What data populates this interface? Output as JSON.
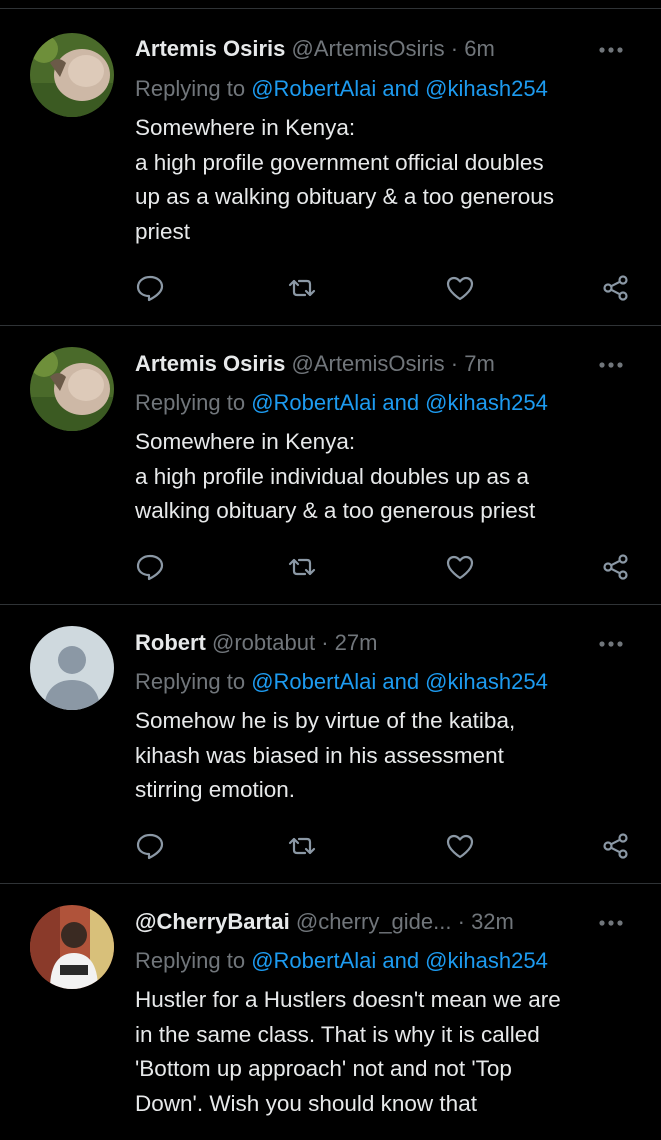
{
  "colors": {
    "background": "#000000",
    "divider": "#2f3336",
    "text_primary": "#e7e9ea",
    "text_secondary": "#71767b",
    "link": "#1d9bf0"
  },
  "tweets": [
    {
      "avatar_icon": "user-photo-avatar",
      "name": "Artemis Osiris",
      "handle": "@ArtemisOsiris",
      "separator": "·",
      "time": "6m",
      "replying_label": "Replying to",
      "replying_mentions": "@RobertAlai and @kihash254",
      "lines": [
        "Somewhere in Kenya:",
        "a high profile government official doubles",
        "up as a walking obituary & a too generous",
        "priest"
      ]
    },
    {
      "avatar_icon": "user-photo-avatar",
      "name": "Artemis Osiris",
      "handle": "@ArtemisOsiris",
      "separator": "·",
      "time": "7m",
      "replying_label": "Replying to",
      "replying_mentions": "@RobertAlai and @kihash254",
      "lines": [
        "Somewhere in Kenya:",
        "a high profile individual doubles up as a",
        "walking obituary & a too generous priest"
      ]
    },
    {
      "avatar_icon": "default-user-avatar",
      "name": "Robert",
      "handle": "@robtabut",
      "separator": "·",
      "time": "27m",
      "replying_label": "Replying to",
      "replying_mentions": "@RobertAlai and @kihash254",
      "lines": [
        "Somehow he is by virtue of the katiba,",
        "kihash was biased in his assessment",
        "stirring emotion."
      ]
    },
    {
      "avatar_icon": "user-photo-avatar",
      "name": "@CherryBartai",
      "handle": "@cherry_gide...",
      "separator": "·",
      "time": "32m",
      "replying_label": "Replying to",
      "replying_mentions": "@RobertAlai and @kihash254",
      "lines": [
        "Hustler for a Hustlers doesn't mean we are",
        "in the same class. That is why it is called",
        "'Bottom up approach' not and not 'Top",
        "Down'. Wish you should know that"
      ]
    }
  ],
  "action_icons": [
    "reply-icon",
    "retweet-icon",
    "like-icon",
    "share-icon"
  ]
}
